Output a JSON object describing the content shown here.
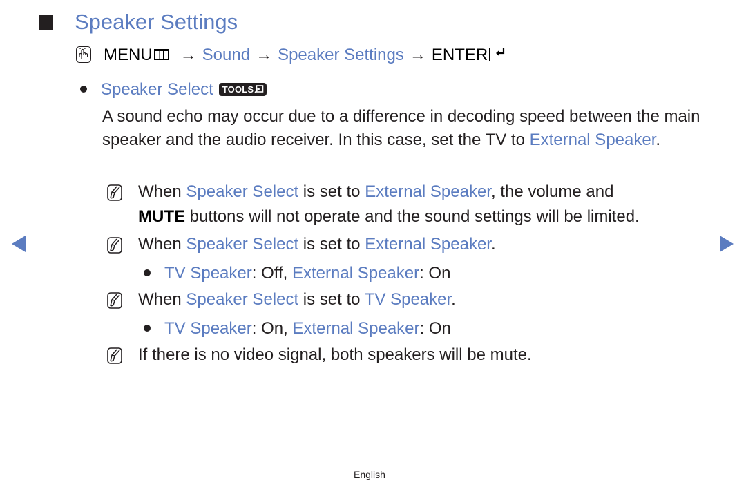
{
  "heading": {
    "title": "Speaker Settings"
  },
  "path": {
    "menu": "MENU",
    "arrow": "→",
    "sound": "Sound",
    "speaker_settings": "Speaker Settings",
    "enter": "ENTER"
  },
  "option": {
    "label": "Speaker Select",
    "tools_badge": "TOOLS"
  },
  "description": {
    "part1": "A sound echo may occur due to a difference in decoding speed between the main speaker and the audio receiver. In this case, set the TV to ",
    "link": "External Speaker",
    "part2": "."
  },
  "notes": [
    {
      "when": "When ",
      "speaker_select": "Speaker Select",
      "is_set_to": " is set to ",
      "value": "External Speaker",
      "rest_line1": ", the volume and",
      "mute": "MUTE",
      "rest_line2": " buttons will not operate and the sound settings will be limited."
    },
    {
      "when": "When ",
      "speaker_select": "Speaker Select",
      "is_set_to": " is set to ",
      "value": "External Speaker",
      "end": ".",
      "sub": {
        "tv_speaker": "TV Speaker",
        "tv_state": ": Off, ",
        "external_speaker": "External Speaker",
        "ext_state": ": On"
      }
    },
    {
      "when": "When ",
      "speaker_select": "Speaker Select",
      "is_set_to": " is set to ",
      "value": "TV Speaker",
      "end": ".",
      "sub": {
        "tv_speaker": "TV Speaker",
        "tv_state": ": On, ",
        "external_speaker": "External Speaker",
        "ext_state": ": On"
      }
    },
    {
      "text": "If there is no video signal, both speakers will be mute."
    }
  ],
  "navigation": {
    "prev_icon": "triangle-left",
    "next_icon": "triangle-right"
  },
  "footer": {
    "language": "English"
  },
  "colors": {
    "accent": "#5b7cc0",
    "text": "#231f20"
  }
}
